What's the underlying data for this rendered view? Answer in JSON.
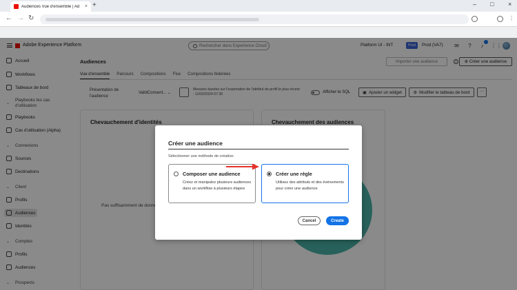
{
  "browser": {
    "tab_title": "Audiences Vue d'ensemble | Ad",
    "tab_close": "×",
    "new_tab": "+",
    "win_min": "–",
    "win_max": "□",
    "win_close": "×",
    "back": "←",
    "forward": "→",
    "reload": "↻"
  },
  "header": {
    "app_name": "Adobe Experience Platform",
    "search_placeholder": "Rechercher dans Experience Cloud",
    "org": "Platform UI - INT",
    "sandbox_badge": "Prod",
    "sandbox": "Prod (VA7)",
    "icons": [
      "comment-icon",
      "help-icon",
      "bell-icon",
      "apps-icon"
    ]
  },
  "sidebar": {
    "items": [
      {
        "label": "Accueil",
        "section": false
      },
      {
        "label": "Workflows",
        "section": false
      },
      {
        "label": "Tableaux de bord",
        "section": false
      },
      {
        "label": "Playbooks les cas d'utilisation",
        "section": true
      },
      {
        "label": "Playbooks",
        "section": false
      },
      {
        "label": "Cas d'utilisation (Alpha)",
        "section": false
      },
      {
        "label": "Connexions",
        "section": true
      },
      {
        "label": "Sources",
        "section": false
      },
      {
        "label": "Destinations",
        "section": false
      },
      {
        "label": "Client",
        "section": true
      },
      {
        "label": "Profils",
        "section": false
      },
      {
        "label": "Audiences",
        "section": false,
        "active": true
      },
      {
        "label": "Identités",
        "section": false
      },
      {
        "label": "Comptes",
        "section": true
      },
      {
        "label": "Profils",
        "section": false
      },
      {
        "label": "Audiences",
        "section": false
      },
      {
        "label": "Prospects",
        "section": true
      }
    ]
  },
  "main": {
    "title": "Audiences",
    "import_button": "Importer une audience",
    "create_button": "Créer une audience",
    "tabs": [
      "Vue d'ensemble",
      "Parcours",
      "Compositions",
      "Flux",
      "Compositions fédérées"
    ],
    "filter_label": "Présentation de l'audience",
    "filter_value": "ValidConsent...",
    "filter_note": "Mesures basées sur l'exportation de l'attribut de profil le plus récent : 12/02/2024 07:30",
    "sql_label": "Afficher le SQL",
    "add_widget": "Ajouter un widget",
    "edit_dashboard": "Modifier le tableau de bord",
    "more": "···",
    "card_left_title": "Chevauchement d'identités",
    "card_left_empty": "Pas suffisamment de données",
    "card_right_title": "Chevauchement des audiences"
  },
  "modal": {
    "title": "Créer une audience",
    "subtitle": "Sélectionner une méthode de création.",
    "options": [
      {
        "title": "Composer une audience",
        "desc": "Créez et manipulez plusieurs audiences dans un workflow à plusieurs étapes",
        "selected": false
      },
      {
        "title": "Créer une règle",
        "desc": "Utilisez des attributs et des événements pour créer une audience",
        "selected": true
      }
    ],
    "cancel": "Cancel",
    "create": "Create"
  },
  "colors": {
    "accent": "#1473e6",
    "adobe_red": "#eb1000",
    "donut": "#4bb3a9",
    "arrow": "#e8302a"
  }
}
